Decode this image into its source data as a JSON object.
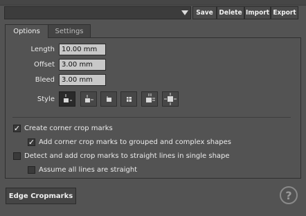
{
  "preset": {
    "selected_value": "",
    "buttons": {
      "save": "Save",
      "delete": "Delete",
      "import": "Import",
      "export": "Export"
    }
  },
  "tabs": [
    {
      "label": "Options",
      "active": true
    },
    {
      "label": "Settings",
      "active": false
    }
  ],
  "options": {
    "length": {
      "label": "Length",
      "value": "10.00 mm"
    },
    "offset": {
      "label": "Offset",
      "value": "3.00 mm"
    },
    "bleed": {
      "label": "Bleed",
      "value": "3.00 mm"
    },
    "style": {
      "label": "Style",
      "selected_index": 0,
      "icons": [
        "crop-style-1-icon",
        "crop-style-2-icon",
        "crop-style-3-icon",
        "crop-style-4-icon",
        "crop-style-5-icon",
        "crop-style-6-icon"
      ]
    },
    "checkboxes": {
      "create_corner": {
        "label": "Create corner crop marks",
        "checked": true
      },
      "add_corner_grouped": {
        "label": "Add corner crop marks to grouped and complex shapes",
        "checked": true
      },
      "detect_straight": {
        "label": "Detect and add crop marks to straight lines in single shape",
        "checked": false
      },
      "assume_straight": {
        "label": "Assume all lines are straight",
        "checked": false
      }
    }
  },
  "footer": {
    "edge_button": "Edge Cropmarks",
    "help_label": "?"
  },
  "colors": {
    "background": "#535353",
    "input_bg": "#c8c8c8",
    "selected_style_bg": "#2a2a2a"
  }
}
